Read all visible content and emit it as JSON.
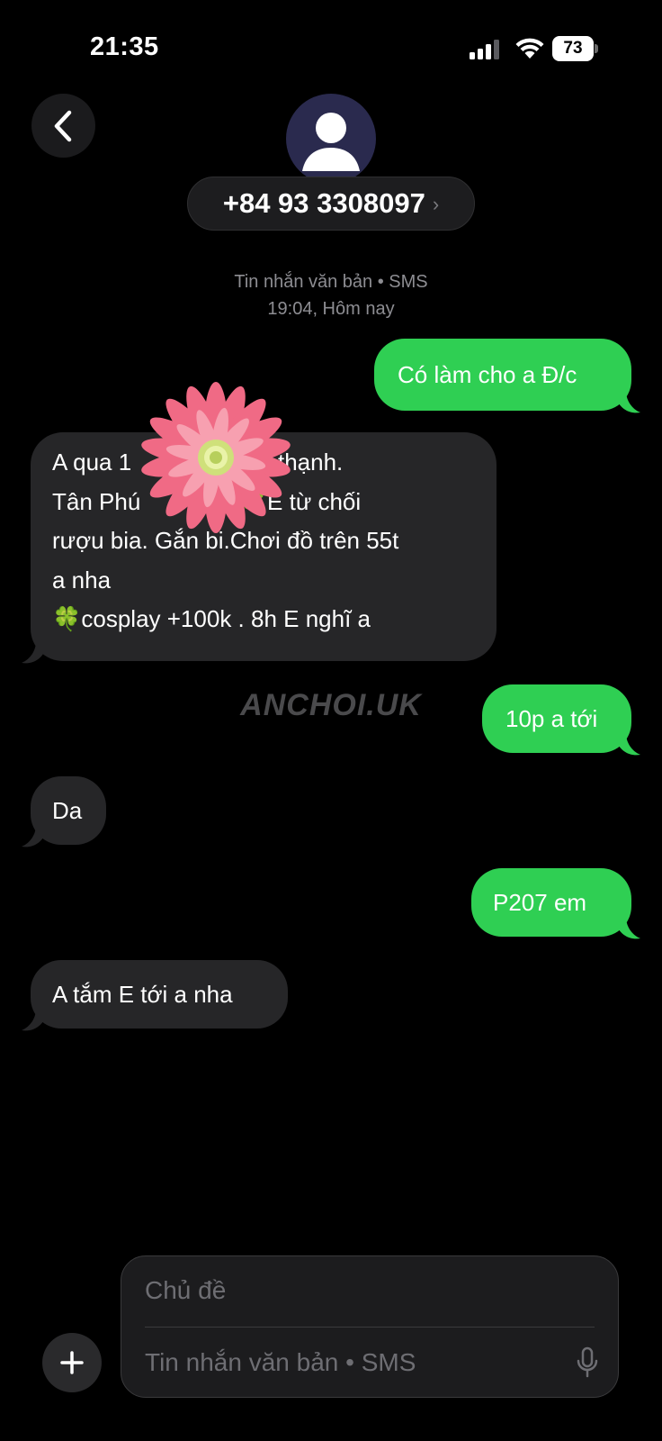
{
  "status_bar": {
    "time": "21:35",
    "battery": "73"
  },
  "header": {
    "contact_number": "+84 93 3308097",
    "chevron": "›"
  },
  "conversation_meta": {
    "line1": "Tin nhắn văn bản • SMS",
    "line2": "19:04, Hôm nay"
  },
  "messages": [
    {
      "direction": "out",
      "text": "Có làm cho a Đ/c"
    },
    {
      "direction": "in",
      "text": "A qua 1         N1. Tây thạnh.\nTân Phú          eu 🍀E từ chối\nrượu bia. Gắn bi.Chơi đồ trên 55t\na nha\n🍀cosplay +100k . 8h E nghĩ a"
    },
    {
      "direction": "out",
      "text": "10p a tới"
    },
    {
      "direction": "in",
      "text": "Da"
    },
    {
      "direction": "out",
      "text": "P207 em"
    },
    {
      "direction": "in",
      "text": "A tắm E tới a nha"
    }
  ],
  "watermark": "ANCHOI.UK",
  "composer": {
    "subject_placeholder": "Chủ đề",
    "message_placeholder": "Tin nhắn văn bản • SMS",
    "plus_label": "+"
  },
  "colors": {
    "outgoing": "#2fcf53",
    "incoming": "#262628",
    "background": "#000000"
  },
  "icons": [
    "signal-icon",
    "wifi-icon",
    "battery-icon",
    "back-chevron-icon",
    "person-avatar-icon",
    "flower-sticker",
    "plus-icon",
    "microphone-icon"
  ]
}
